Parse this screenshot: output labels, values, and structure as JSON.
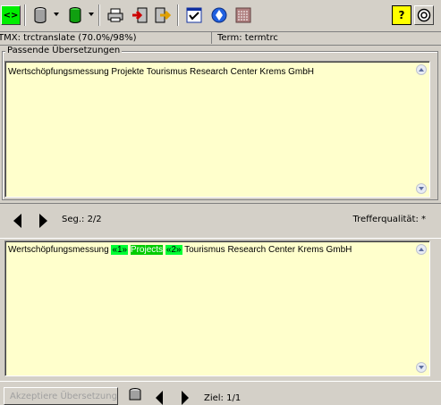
{
  "toolbar": {
    "icons": [
      "tag-toggle-icon",
      "database-icon",
      "database-green-icon",
      "print-icon",
      "import-icon",
      "export-icon",
      "checklist-icon",
      "globe-icon",
      "keyboard-icon",
      "help-icon",
      "settings-icon"
    ],
    "tag_label": "<>",
    "help_label": "?"
  },
  "status": {
    "tm": "TMX: trctranslate  (70.0%/98%)",
    "term": "Term: termtrc"
  },
  "matches": {
    "group_label": "Passende Übersetzungen",
    "source_text": "Wertschöpfungsmessung  Projekte  Tourismus Research Center Krems GmbH"
  },
  "nav": {
    "segment": "Seg.: 2/2",
    "quality": "Trefferqualität: *"
  },
  "target": {
    "prefix": "Wertschöpfungsmessung ",
    "tag1": "«1»",
    "word": "Projects",
    "tag2": "«2»",
    "suffix": " Tourismus Research Center Krems GmbH"
  },
  "bottom": {
    "accept_label": "Akzeptiere Übersetzung",
    "target_label": "Ziel: 1/1"
  },
  "colors": {
    "textarea_bg": "#ffffcc",
    "tag_green": "#00ff33",
    "window_bg": "#d4d0c8"
  }
}
